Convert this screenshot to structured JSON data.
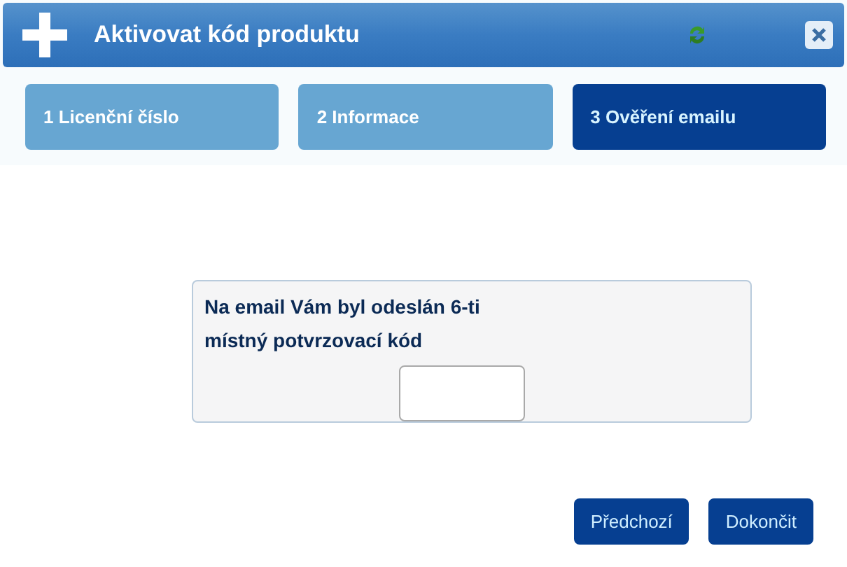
{
  "window": {
    "title": "Aktivovat kód produktu"
  },
  "steps": [
    {
      "label": "1 Licenční číslo",
      "selected": false
    },
    {
      "label": "2 Informace",
      "selected": false
    },
    {
      "label": "3 Ověření emailu",
      "selected": true
    }
  ],
  "message": "Na email Vám byl odeslán 6-ti místný potvrzovací kód",
  "buttons": [
    "Předchozí",
    "Dokončit"
  ]
}
